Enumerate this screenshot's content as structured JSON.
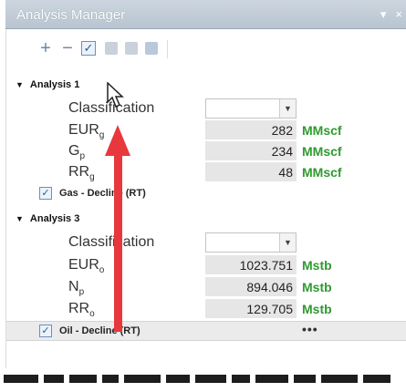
{
  "window": {
    "title": "Analysis Manager"
  },
  "toolbar": {
    "add_icon": "plus-icon",
    "remove_icon": "minus-icon",
    "check_icon": "checkbox-icon"
  },
  "groups": [
    {
      "name": "Analysis 1",
      "classification_label": "Classification",
      "classification_value": "",
      "rows": [
        {
          "label": "EUR",
          "sub": "g",
          "value": "282",
          "unit": "MMscf"
        },
        {
          "label": "G",
          "sub": "p",
          "value": "234",
          "unit": "MMscf"
        },
        {
          "label": "RR",
          "sub": "g",
          "value": "48",
          "unit": "MMscf"
        }
      ],
      "model": {
        "label": "Gas - Decline (RT)",
        "checked": true,
        "more": ""
      }
    },
    {
      "name": "Analysis 3",
      "classification_label": "Classification",
      "classification_value": "",
      "rows": [
        {
          "label": "EUR",
          "sub": "o",
          "value": "1023.751",
          "unit": "Mstb"
        },
        {
          "label": "N",
          "sub": "p",
          "value": "894.046",
          "unit": "Mstb"
        },
        {
          "label": "RR",
          "sub": "o",
          "value": "129.705",
          "unit": "Mstb"
        }
      ],
      "model": {
        "label": "Oil - Decline (RT)",
        "checked": true,
        "more": "•••"
      }
    }
  ],
  "colors": {
    "unit_green": "#2f9a2f",
    "annotation_arrow": "#e8383d"
  }
}
